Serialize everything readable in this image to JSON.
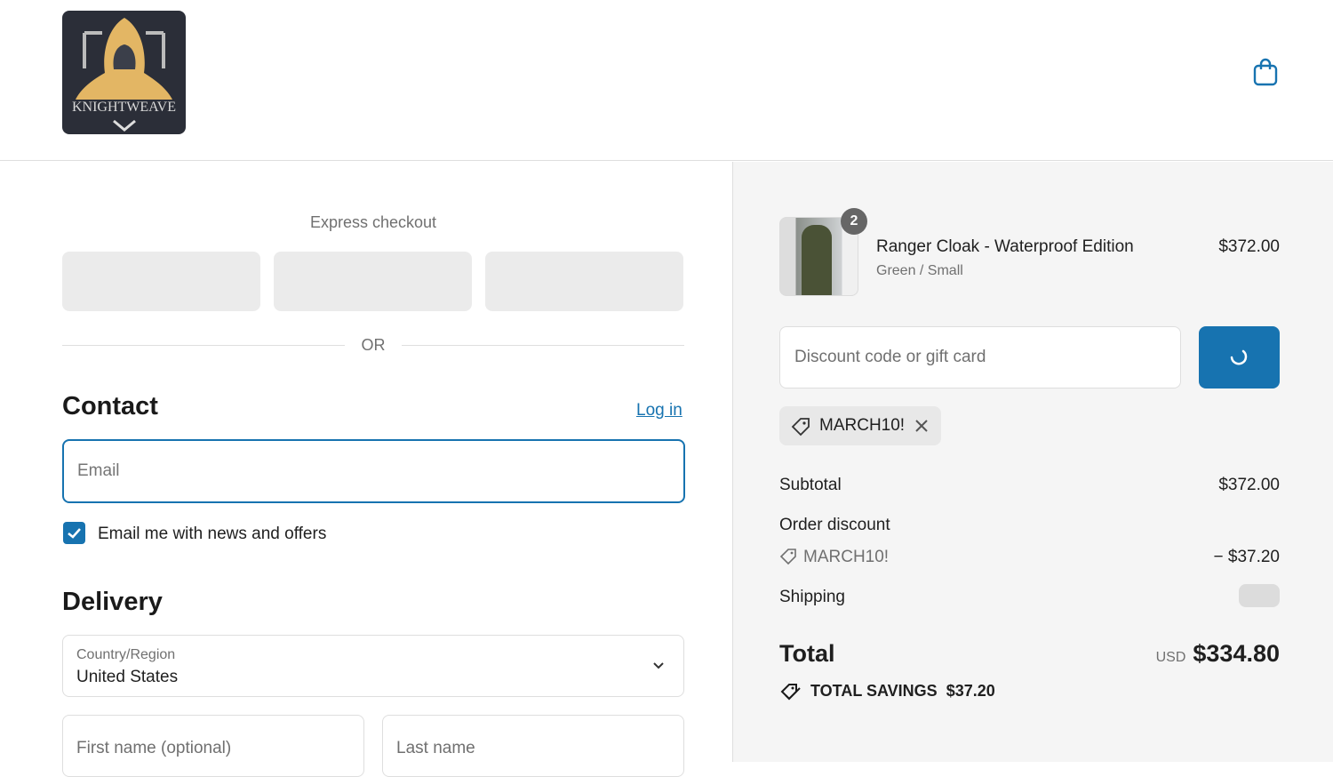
{
  "header": {
    "logo_text": "KNIGHTWEAVE"
  },
  "express": {
    "label": "Express checkout",
    "or": "OR"
  },
  "contact": {
    "title": "Contact",
    "login": "Log in",
    "email_placeholder": "Email",
    "newsletter_label": "Email me with news and offers",
    "newsletter_checked": true
  },
  "delivery": {
    "title": "Delivery",
    "country_label": "Country/Region",
    "country_value": "United States",
    "first_name_placeholder": "First name (optional)",
    "last_name_placeholder": "Last name"
  },
  "summary": {
    "item": {
      "name": "Ranger Cloak - Waterproof Edition",
      "variant": "Green / Small",
      "price": "$372.00",
      "quantity": "2"
    },
    "discount_placeholder": "Discount code or gift card",
    "applied_code": "MARCH10!",
    "subtotal_label": "Subtotal",
    "subtotal": "$372.00",
    "order_discount_label": "Order discount",
    "discount_code": "MARCH10!",
    "discount_amount": "− $37.20",
    "shipping_label": "Shipping",
    "total_label": "Total",
    "currency": "USD",
    "total": "$334.80",
    "savings_label": "TOTAL SAVINGS",
    "savings": "$37.20"
  },
  "colors": {
    "accent": "#1773b0"
  }
}
